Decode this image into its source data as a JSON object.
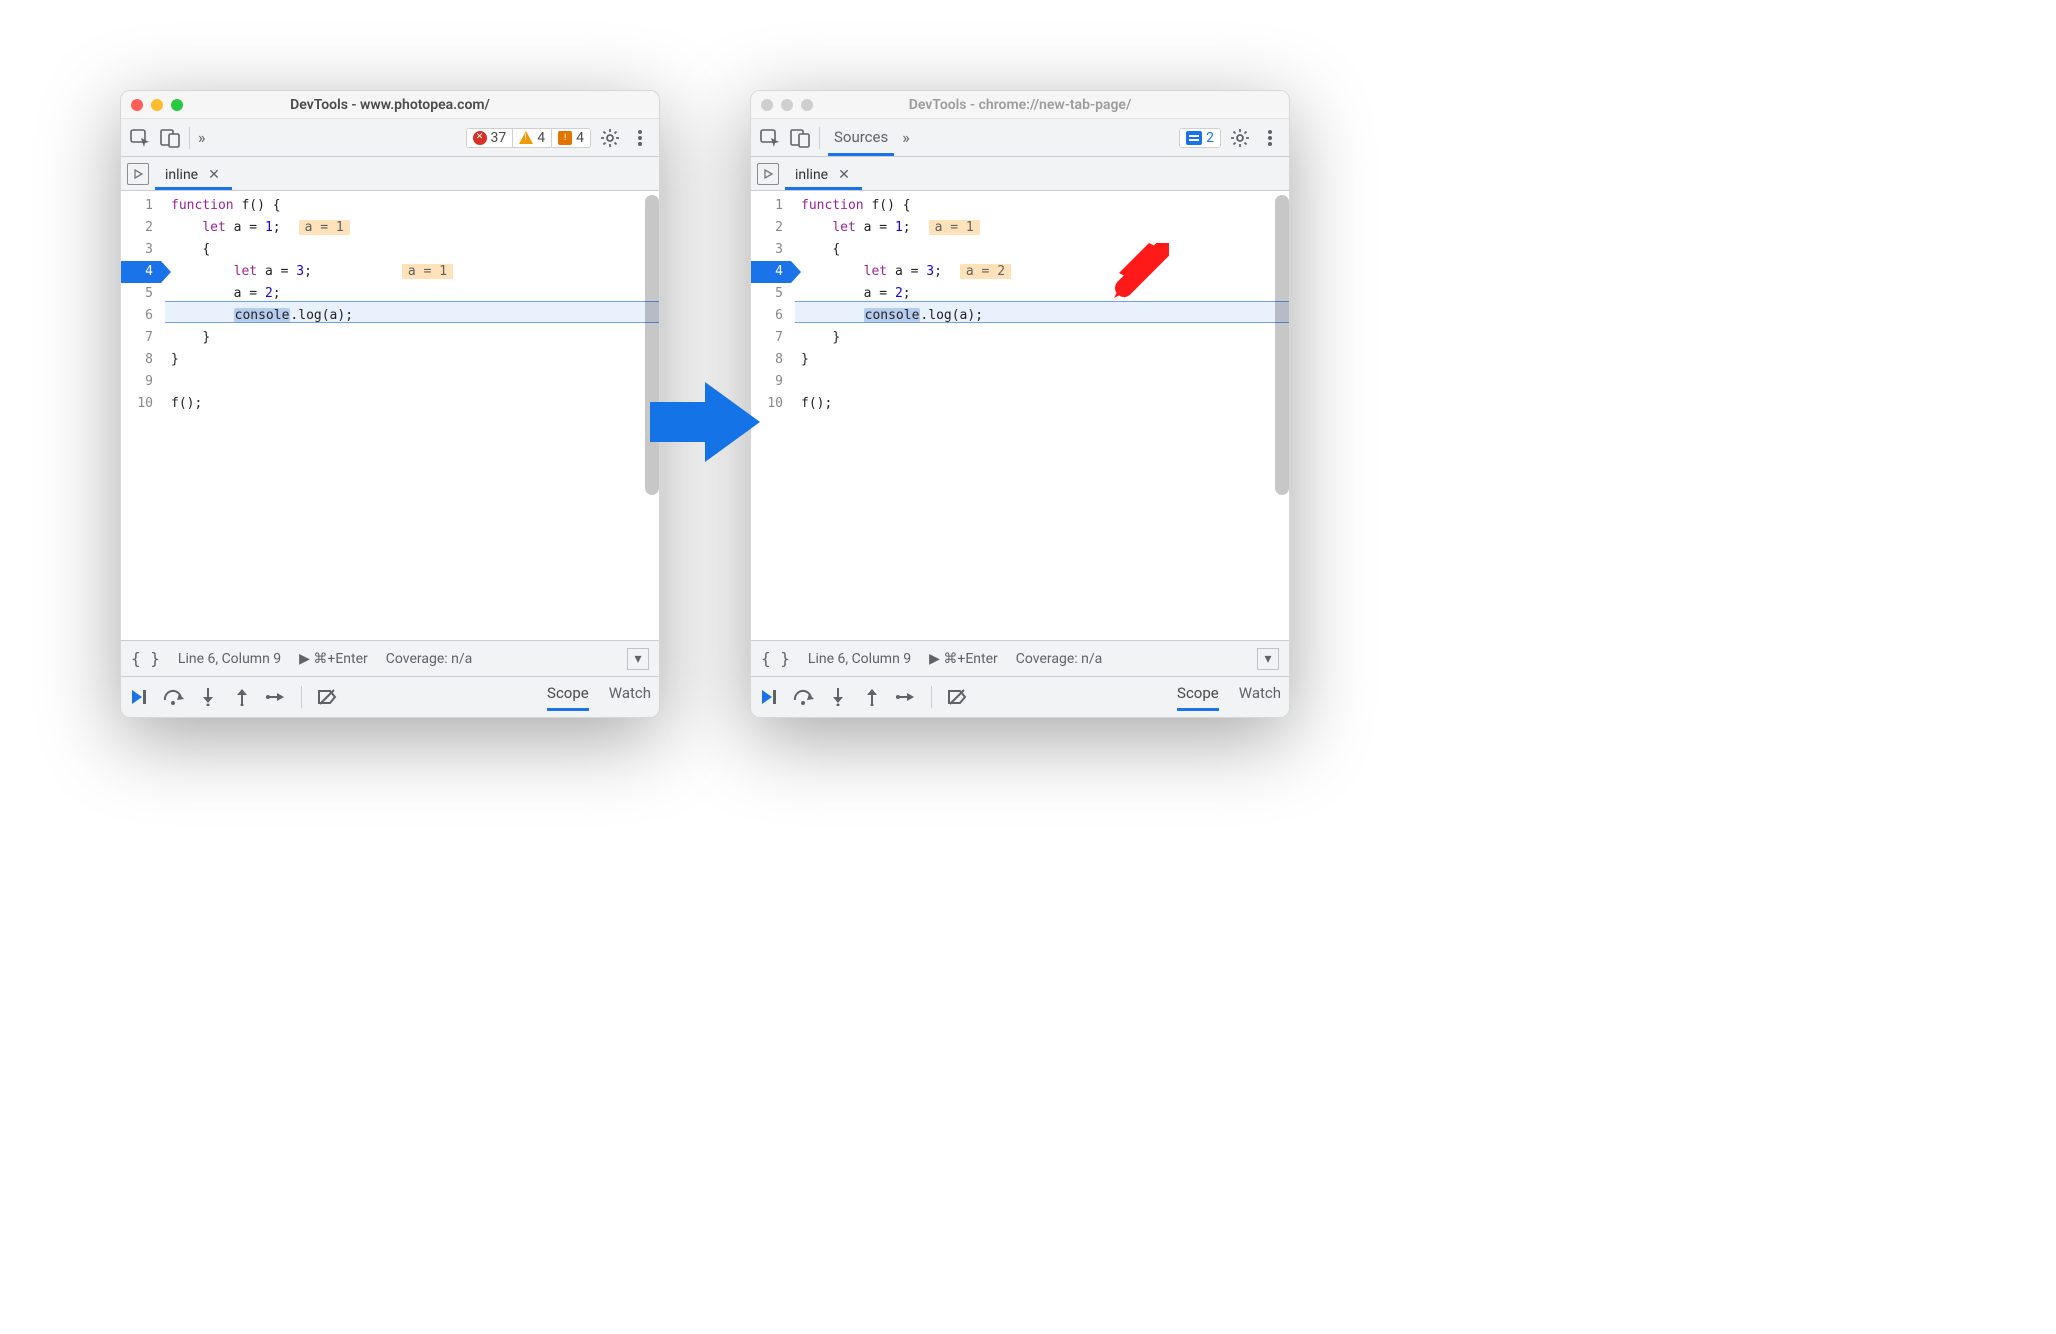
{
  "left": {
    "title": "DevTools - www.photopea.com/",
    "active": true,
    "toolbar": {
      "errors": "37",
      "warnings": "4",
      "issues": "4"
    },
    "tab": {
      "name": "inline"
    },
    "code": {
      "lines": [
        "1",
        "2",
        "3",
        "4",
        "5",
        "6",
        "7",
        "8",
        "9",
        "10"
      ],
      "stopped_line": "4",
      "inline_a_line2": "a = 1",
      "inline_a_line4": "a = 1"
    },
    "status": {
      "pos": "Line 6, Column 9",
      "enter": "▶ ⌘+Enter",
      "cov": "Coverage: n/a"
    },
    "debug_tabs": {
      "scope": "Scope",
      "watch": "Watch"
    },
    "source": {
      "kw_function": "function",
      "fname": "f",
      "paren": "() {",
      "kw_let": "let",
      "var_a": "a",
      "eq": "=",
      "n1": "1",
      "semi": ";",
      "brace_o": "{",
      "n3": "3",
      "n2": "2",
      "console": "console",
      "dot": ".",
      "log": "log",
      "args": "(a);",
      "brace_c": "}",
      "call": "f();"
    }
  },
  "right": {
    "title": "DevTools - chrome://new-tab-page/",
    "active": false,
    "toolbar": {
      "sources": "Sources",
      "messages": "2"
    },
    "tab": {
      "name": "inline"
    },
    "code": {
      "inline_a_line2": "a = 1",
      "inline_a_line4": "a = 2"
    },
    "status": {
      "pos": "Line 6, Column 9",
      "enter": "▶ ⌘+Enter",
      "cov": "Coverage: n/a"
    },
    "debug_tabs": {
      "scope": "Scope",
      "watch": "Watch"
    }
  }
}
